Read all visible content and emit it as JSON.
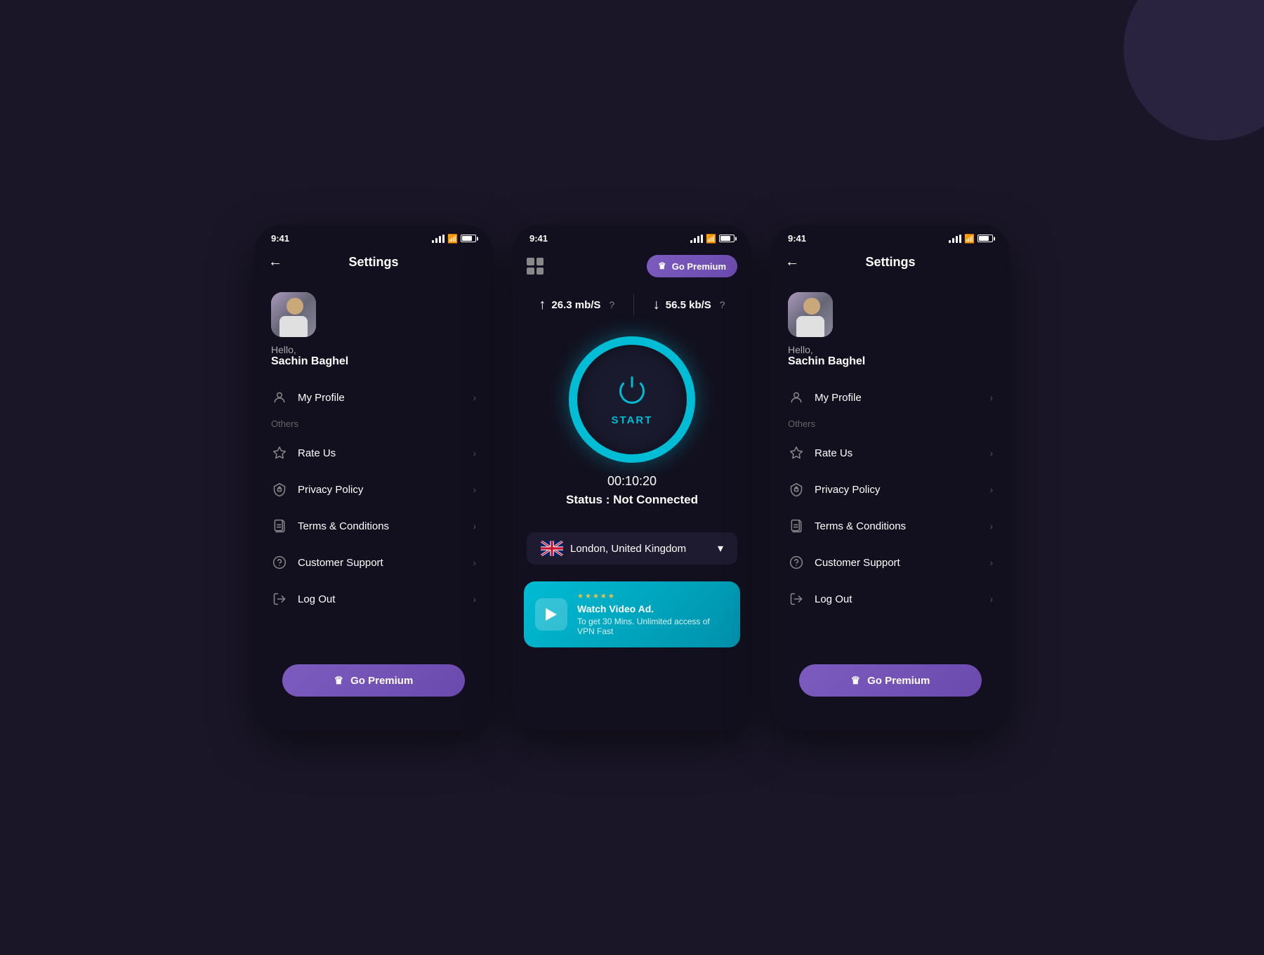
{
  "app": {
    "background_color": "#1a1628"
  },
  "screens": {
    "left": {
      "type": "settings",
      "status_bar": {
        "time": "9:41",
        "signal": "signal",
        "wifi": "wifi",
        "battery": "battery"
      },
      "header": {
        "back_label": "←",
        "title": "Settings"
      },
      "profile": {
        "greeting": "Hello,",
        "name": "Sachin Baghel"
      },
      "menu_items": [
        {
          "id": "my-profile",
          "label": "My Profile",
          "icon": "profile-icon"
        },
        {
          "id": "others-section",
          "label": "Others",
          "type": "section"
        },
        {
          "id": "rate-us",
          "label": "Rate Us",
          "icon": "star-icon"
        },
        {
          "id": "privacy-policy",
          "label": "Privacy Policy",
          "icon": "shield-icon"
        },
        {
          "id": "terms-conditions",
          "label": "Terms & Conditions",
          "icon": "document-icon"
        },
        {
          "id": "customer-support",
          "label": "Customer Support",
          "icon": "help-icon"
        },
        {
          "id": "log-out",
          "label": "Log Out",
          "icon": "logout-icon"
        }
      ],
      "premium_button": {
        "label": "Go Premium",
        "icon": "crown-icon"
      }
    },
    "middle": {
      "type": "vpn",
      "status_bar": {
        "time": "9:41",
        "signal": "signal",
        "wifi": "wifi",
        "battery": "battery"
      },
      "premium_button": {
        "label": "Go Premium",
        "icon": "crown-icon"
      },
      "upload_speed": {
        "value": "26.3 mb/S",
        "icon": "upload-icon"
      },
      "download_speed": {
        "value": "56.5 kb/S",
        "icon": "download-icon"
      },
      "vpn_button": {
        "label": "START"
      },
      "timer": "00:10:20",
      "status": "Status : Not Connected",
      "location": {
        "name": "London, United Kingdom",
        "country_code": "GB"
      },
      "ad_banner": {
        "title": "Watch Video Ad.",
        "subtitle": "To get 30 Mins. Unlimited access of VPN Fast",
        "stars": [
          "★",
          "★",
          "★",
          "★",
          "★"
        ]
      }
    },
    "right": {
      "type": "settings",
      "status_bar": {
        "time": "9:41",
        "signal": "signal",
        "wifi": "wifi",
        "battery": "battery"
      },
      "header": {
        "back_label": "←",
        "title": "Settings"
      },
      "profile": {
        "greeting": "Hello,",
        "name": "Sachin Baghel"
      },
      "menu_items": [
        {
          "id": "my-profile",
          "label": "My Profile",
          "icon": "profile-icon"
        },
        {
          "id": "others-section",
          "label": "Others",
          "type": "section"
        },
        {
          "id": "rate-us",
          "label": "Rate Us",
          "icon": "star-icon"
        },
        {
          "id": "privacy-policy",
          "label": "Privacy Policy",
          "icon": "shield-icon"
        },
        {
          "id": "terms-conditions",
          "label": "Terms & Conditions",
          "icon": "document-icon"
        },
        {
          "id": "customer-support",
          "label": "Customer Support",
          "icon": "help-icon"
        },
        {
          "id": "log-out",
          "label": "Log Out",
          "icon": "logout-icon"
        }
      ],
      "premium_button": {
        "label": "Go Premium",
        "icon": "crown-icon"
      }
    }
  }
}
